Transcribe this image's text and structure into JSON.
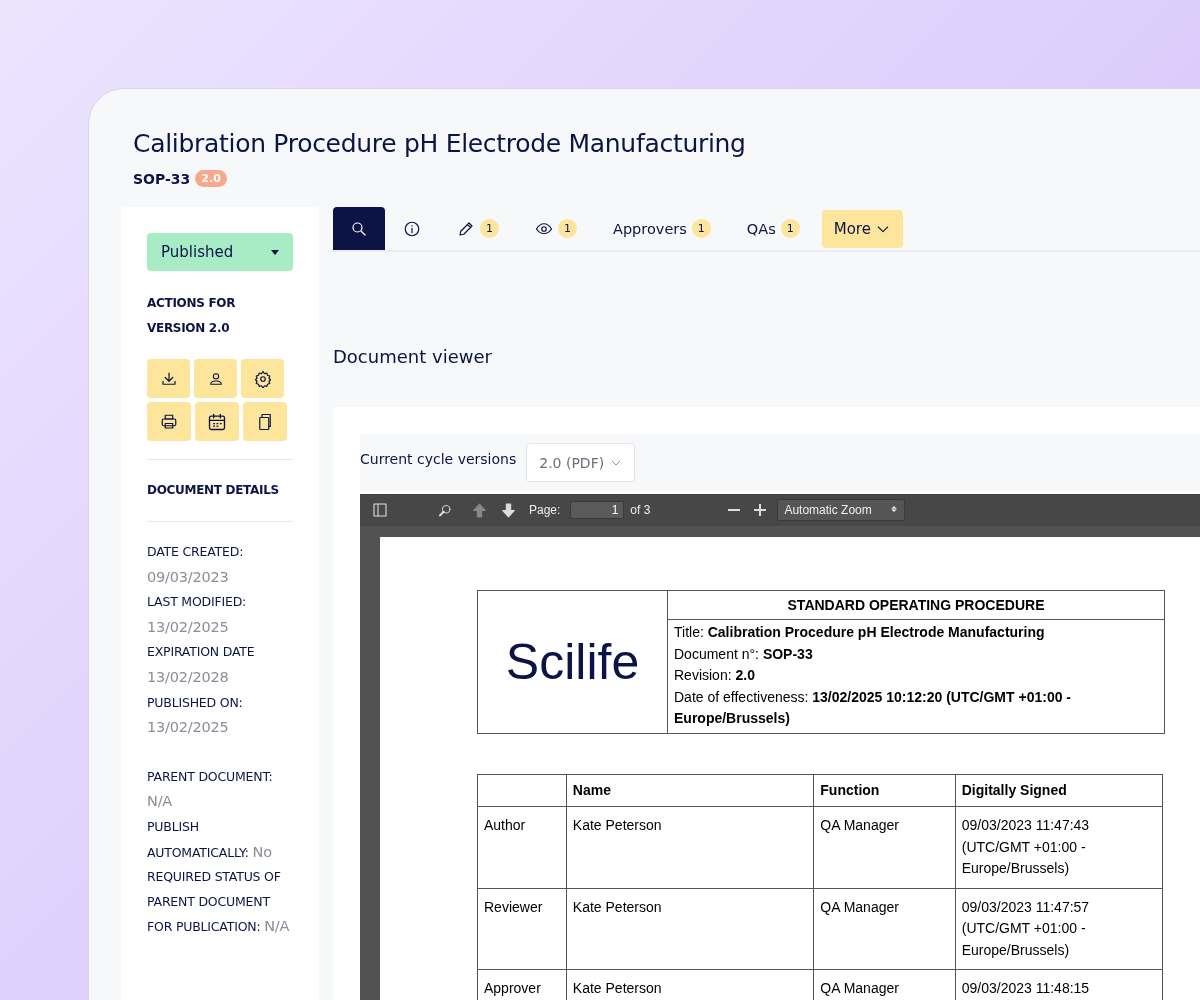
{
  "document": {
    "title": "Calibration Procedure pH Electrode Manufacturing",
    "code": "SOP-33",
    "version": "2.0"
  },
  "sidebar": {
    "status": "Published",
    "actions_heading": "ACTIONS FOR VERSION 2.0",
    "action_buttons": [
      {
        "kind": "download"
      },
      {
        "kind": "user"
      },
      {
        "kind": "settings"
      },
      {
        "kind": "print"
      },
      {
        "kind": "calendar"
      },
      {
        "kind": "copy"
      }
    ],
    "details_heading": "DOCUMENT DETAILS",
    "detail_groups": [
      [
        {
          "label": "DATE CREATED:",
          "value": "09/03/2023"
        },
        {
          "label": "LAST MODIFIED:",
          "value": "13/02/2025"
        },
        {
          "label": "EXPIRATION DATE",
          "value": "13/02/2028"
        },
        {
          "label": "PUBLISHED ON:",
          "value": "13/02/2025"
        }
      ],
      [
        {
          "label": "PARENT DOCUMENT:",
          "value": "N/A"
        },
        {
          "label": "PUBLISH AUTOMATICALLY:",
          "value": "No"
        },
        {
          "label": "REQUIRED STATUS OF PARENT DOCUMENT FOR PUBLICATION:",
          "value": "N/A"
        }
      ]
    ]
  },
  "tabs": [
    {
      "kind": "search",
      "selected": true
    },
    {
      "kind": "info",
      "selected": false
    },
    {
      "kind": "edit",
      "selected": false,
      "badge": "1"
    },
    {
      "kind": "view",
      "selected": false,
      "badge": "1"
    },
    {
      "kind": "text",
      "selected": false,
      "label": "Approvers",
      "badge": "1"
    },
    {
      "kind": "text",
      "selected": false,
      "label": "QAs",
      "badge": "1"
    }
  ],
  "more_button": "More",
  "viewer": {
    "heading": "Document viewer",
    "versions_label": "Current cycle versions",
    "version_select": "2.0 (PDF)",
    "toolbar": {
      "page_label": "Page:",
      "page_value": "1",
      "page_count": "of 3",
      "zoom": "Automatic Zoom"
    },
    "page": {
      "logo": "Scilife",
      "heading": "STANDARD OPERATING PROCEDURE",
      "lines": [
        "Title: **Calibration Procedure pH Electrode Manufacturing**",
        "Document n°: **SOP-33**",
        "Revision: **2.0**",
        "Date of effectiveness: **13/02/2025 10:12:20 (UTC/GMT +01:00 - Europe/Brussels)**"
      ],
      "columns": [
        "Name",
        "Function",
        "Digitally Signed"
      ],
      "rows": [
        {
          "role": "Author",
          "name": "Kate Peterson",
          "function": "QA Manager",
          "signed": [
            "09/03/2023 11:47:43",
            "(UTC/GMT +01:00 -",
            "Europe/Brussels)"
          ]
        },
        {
          "role": "Reviewer",
          "name": "Kate Peterson",
          "function": "QA Manager",
          "signed": [
            "09/03/2023 11:47:57",
            "(UTC/GMT +01:00 -",
            "Europe/Brussels)"
          ]
        },
        {
          "role": "Approver",
          "name": "Kate Peterson",
          "function": "QA Manager",
          "signed": [
            "09/03/2023 11:48:15"
          ]
        }
      ]
    }
  }
}
